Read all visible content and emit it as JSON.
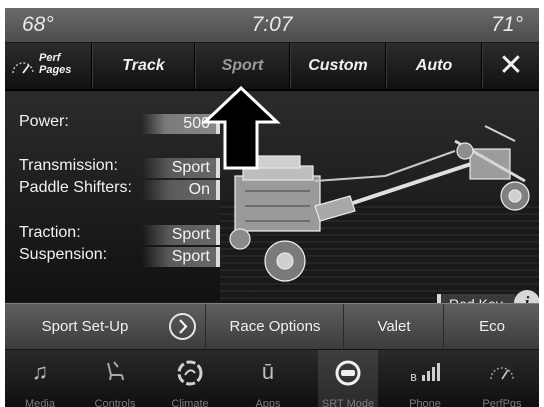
{
  "status_bar": {
    "outside_temp": "68°",
    "time": "7:07",
    "inside_temp": "71°"
  },
  "mode_tabs": {
    "perf_pages": [
      "Perf",
      "Pages"
    ],
    "items": [
      "Track",
      "Sport",
      "Custom",
      "Auto"
    ],
    "selected": "Sport",
    "close": "✕"
  },
  "settings": {
    "power": {
      "label": "Power:",
      "value": "500"
    },
    "transmission": {
      "label": "Transmission:",
      "value": "Sport"
    },
    "paddle_shifters": {
      "label": "Paddle Shifters:",
      "value": "On"
    },
    "traction": {
      "label": "Traction:",
      "value": "Sport"
    },
    "suspension": {
      "label": "Suspension:",
      "value": "Sport"
    }
  },
  "key_status": {
    "label": "Red Key",
    "info_icon": "i"
  },
  "options_bar": {
    "setup": "Sport Set-Up",
    "race_options": "Race Options",
    "valet": "Valet",
    "eco": "Eco"
  },
  "dock": {
    "items": [
      {
        "icon": "music-note-icon",
        "label": "Media"
      },
      {
        "icon": "seat-controls-icon",
        "label": "Controls"
      },
      {
        "icon": "climate-icon",
        "label": "Climate"
      },
      {
        "icon": "apps-icon",
        "label": "Apps"
      },
      {
        "icon": "srt-steering-icon",
        "label": "SRT Mode"
      },
      {
        "icon": "phone-bluetooth-icon",
        "label": "Phone"
      },
      {
        "icon": "perf-pages-icon",
        "label": "PerfPgs"
      }
    ],
    "active": "SRT Mode"
  },
  "colors": {
    "accent_light": "#d8d8d8",
    "background": "#161616"
  }
}
